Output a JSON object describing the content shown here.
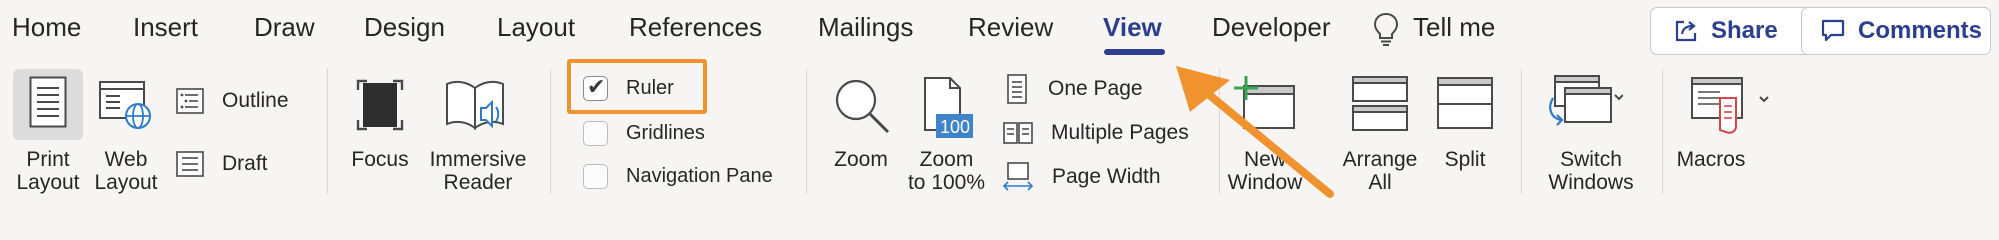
{
  "tabs": [
    {
      "label": "Home"
    },
    {
      "label": "Insert"
    },
    {
      "label": "Draw"
    },
    {
      "label": "Design"
    },
    {
      "label": "Layout"
    },
    {
      "label": "References"
    },
    {
      "label": "Mailings"
    },
    {
      "label": "Review"
    },
    {
      "label": "View",
      "active": true
    },
    {
      "label": "Developer"
    }
  ],
  "tell_me": {
    "label": "Tell me",
    "icon": "lightbulb-icon"
  },
  "share": {
    "label": "Share",
    "icon": "share-icon"
  },
  "comments": {
    "label": "Comments",
    "icon": "comment-icon"
  },
  "views": {
    "print_layout": {
      "line1": "Print",
      "line2": "Layout",
      "selected": true
    },
    "web_layout": {
      "line1": "Web",
      "line2": "Layout"
    },
    "outline": {
      "label": "Outline"
    },
    "draft": {
      "label": "Draft"
    }
  },
  "immersive": {
    "focus": {
      "label": "Focus"
    },
    "reader": {
      "line1": "Immersive",
      "line2": "Reader"
    }
  },
  "show": {
    "ruler": {
      "label": "Ruler",
      "checked": true
    },
    "gridlines": {
      "label": "Gridlines",
      "checked": false
    },
    "nav_pane": {
      "label": "Navigation Pane",
      "checked": false
    }
  },
  "zoom": {
    "zoom": {
      "label": "Zoom"
    },
    "zoom100": {
      "line1": "Zoom",
      "line2": "to 100%",
      "badge": "100"
    },
    "one_page": {
      "label": "One Page"
    },
    "multiple_pages": {
      "label": "Multiple Pages"
    },
    "page_width": {
      "label": "Page Width"
    }
  },
  "window": {
    "new_window": {
      "line1": "New",
      "line2": "Window"
    },
    "arrange_all": {
      "line1": "Arrange",
      "line2": "All"
    },
    "split": {
      "label": "Split"
    },
    "switch_windows": {
      "line1": "Switch",
      "line2": "Windows"
    }
  },
  "macros": {
    "label": "Macros"
  },
  "colors": {
    "accent": "#2b3f8e",
    "annotation": "#f0922e",
    "ribbon_bg": "#f6f5f4"
  }
}
